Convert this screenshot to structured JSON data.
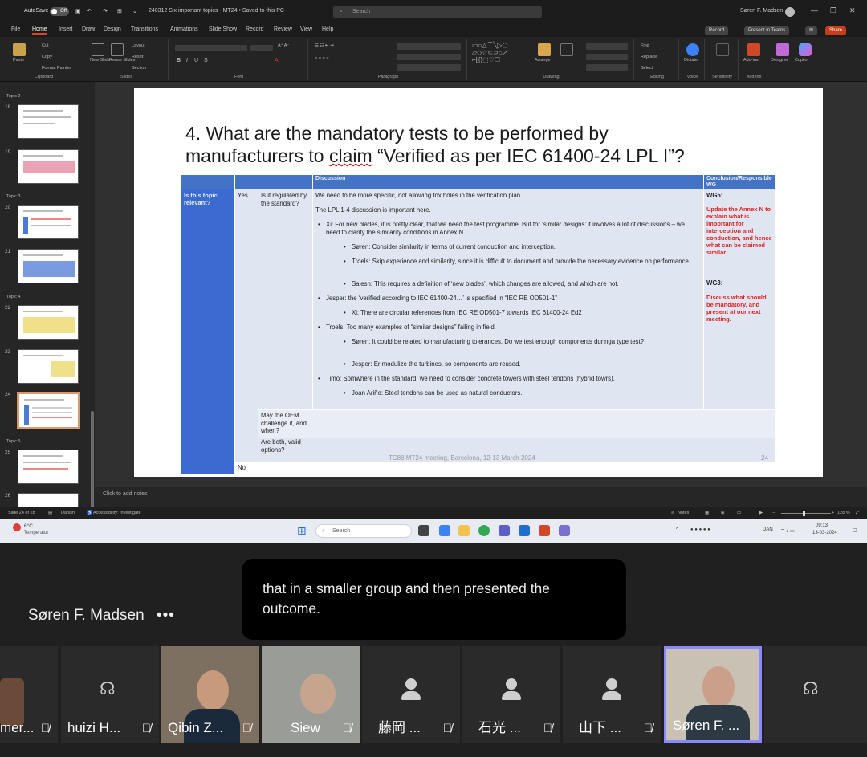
{
  "window": {
    "autosave": "AutoSave",
    "autosave_state": "Off",
    "doc_title": "240312 Six important topics - MT24 • Saved to this PC",
    "search_placeholder": "Search",
    "user": "Søren F. Madsen"
  },
  "menu": {
    "items": [
      "File",
      "Home",
      "Insert",
      "Draw",
      "Design",
      "Transitions",
      "Animations",
      "Slide Show",
      "Record",
      "Review",
      "View",
      "Help"
    ],
    "active": "Home",
    "record": "Record",
    "present_teams": "Present in Teams",
    "share": "Share"
  },
  "ribbon": {
    "groups": {
      "clipboard": "Clipboard",
      "slides": "Slides",
      "font": "Font",
      "paragraph": "Paragraph",
      "drawing": "Drawing",
      "editing": "Editing",
      "voice": "Voice",
      "sensitivity": "Sensitivity",
      "addins": "Add-ins"
    },
    "paste": "Paste",
    "cut": "Cut",
    "copy": "Copy",
    "format_painter": "Format Painter",
    "new_slide": "New Slide",
    "reuse_slides": "Reuse Slides",
    "layout": "Layout",
    "reset": "Reset",
    "section": "Section",
    "arrange": "Arrange",
    "quick_styles": "Quick Styles",
    "find": "Find",
    "replace": "Replace",
    "select": "Select",
    "dictate": "Dictate",
    "add_ins": "Add-ins",
    "designer": "Designer",
    "copilot": "Copilot"
  },
  "thumbnails": {
    "sections": [
      "Topic 2",
      "Topic 3",
      "Topic 4",
      "Topic 5"
    ],
    "numbers": [
      "18",
      "19",
      "20",
      "21",
      "22",
      "23",
      "24",
      "25",
      "26"
    ],
    "selected": "24"
  },
  "slide": {
    "title_line1": "4. What are the mandatory tests to be performed by",
    "title_line2_a": "manufacturers to ",
    "title_line2_claim": "claim",
    "title_line2_b": " “Verified as per IEC 61400-24 LPL I”?",
    "header_discussion": "Discussion",
    "header_conclusion": "Conclusion/Responsible WG",
    "col1": "Is this topic relevant?",
    "yes": "Yes",
    "no": "No",
    "q1": "Is it regulated by the standard?",
    "q2": "May the OEM challenge it, and when?",
    "q3": "Are both, valid options?",
    "disc": [
      "We need to be more specific, not allowing fox holes in the verification plan.",
      "The LPL 1-4 discussion is important here.",
      "Xi: For new blades, it is pretty clear, that we need the test programme. But for ‘similar designs’ it involves a lot of discussions – we need to clarify the similarity conditions in Annex N.",
      "Søren: Consider similarity in terms of current conduction and interception.",
      "Troels: Skip experience and similarity, since it is difficult to document and provide the necessary evidence on performance.",
      "Saiesh: This requires a definition of ‘new blades’, which changes are allowed, and which are not.",
      "Jesper: the ‘verified according to IEC 61400-24…’ is specified in “IEC RE OD501-1”",
      "Xi: There are circular references from IEC RE OD501-7 towards IEC 61400-24 Ed2",
      "Troels: Too many examples of “similar designs” failing in field.",
      "Søren: It could be related to manufacturing tolerances. Do we test enough components duringa type test?",
      "Jesper: Er modulize the turbines, so components are reused.",
      "Timo: Somwhere in the standard, we need to consider concrete towers with steel tendons (hybrid towrs).",
      "Joan Ariño: Steel tendons can be used as natural conductors."
    ],
    "wg5": "WG5:",
    "wg5_text": "Update the Annex N to explain what is important for interception and conduction, and hence what can be claimed similar.",
    "wg3": "WG3:",
    "wg3_text": "Discuss what should be mandatory, and present at our next meeting.",
    "footer": "TC88 MT24 meeting, Barcelona, 12-13 March 2024",
    "page": "24"
  },
  "notes_placeholder": "Click to add notes",
  "statusbar": {
    "slide": "Slide 24 of 28",
    "lang": "Danish",
    "accessibility": "Accessibility: Investigate",
    "notes": "Notes",
    "zoom": "128 %"
  },
  "taskbar": {
    "weather_temp": "6°C",
    "weather_label": "Temperatur",
    "search": "Search",
    "lang": "DAN",
    "time": "09:13",
    "date": "13-03-2024"
  },
  "meeting": {
    "presenter": "Søren F. Madsen",
    "caption": "that in a smaller group and then presented the outcome.",
    "participants": [
      "mer...",
      "huizi H...",
      "Qibin Z...",
      "Siew",
      "藤岡 ...",
      "石光 ...",
      "山下 ...",
      "Søren F. ..."
    ]
  }
}
